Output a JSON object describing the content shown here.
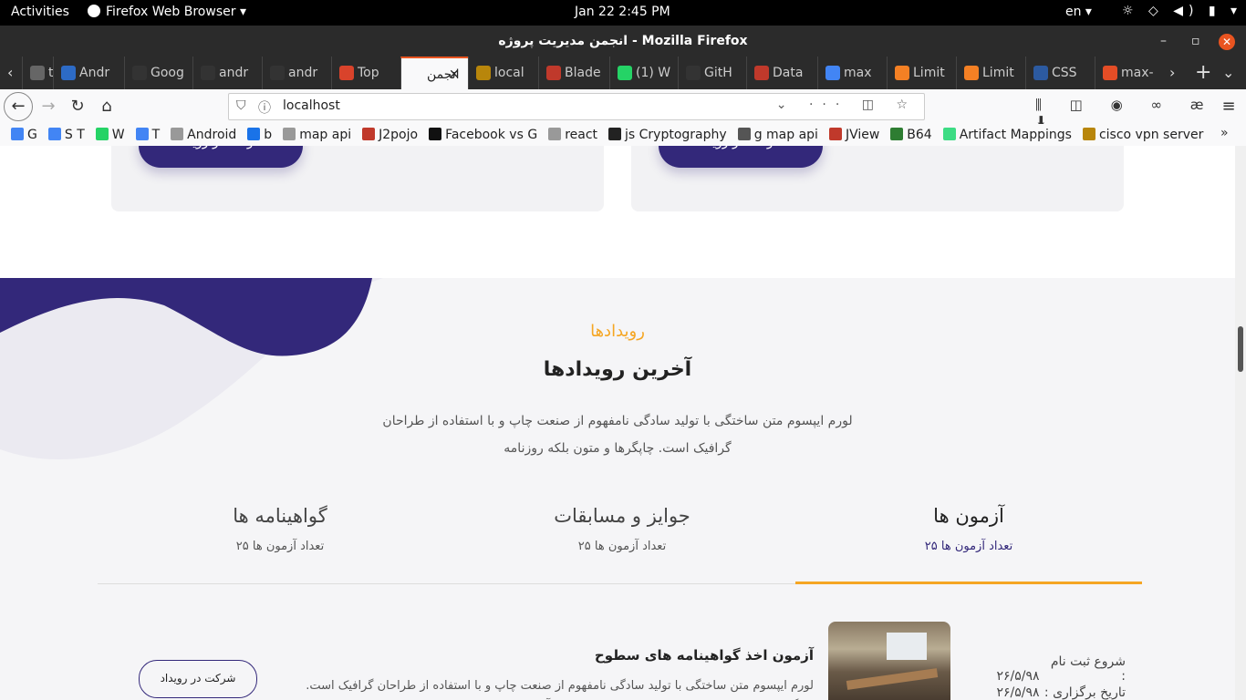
{
  "system": {
    "activities": "Activities",
    "app_menu": "Firefox Web Browser ▾",
    "clock": "Jan 22   2:45 PM",
    "lang": "en ▾",
    "tray_icons": "brightness-icon wifi-icon volume-icon battery-icon"
  },
  "window": {
    "title": "انجمن مدیریت پروژه - Mozilla Firefox"
  },
  "tabs": [
    {
      "label": "tHt",
      "color": "#666"
    },
    {
      "label": "Andr",
      "color": "#2d6bc6"
    },
    {
      "label": "Goog",
      "color": "#333"
    },
    {
      "label": "andr",
      "color": "#333"
    },
    {
      "label": "andr",
      "color": "#333"
    },
    {
      "label": "Top",
      "color": "#d9432b"
    },
    {
      "label": "انجمن",
      "color": "#f9f9fa"
    },
    {
      "label": "local",
      "color": "#b8860b"
    },
    {
      "label": "Blade",
      "color": "#c0392b"
    },
    {
      "label": "(1) W",
      "color": "#25d366"
    },
    {
      "label": "GitH",
      "color": "#333"
    },
    {
      "label": "Data",
      "color": "#c0392b"
    },
    {
      "label": "max",
      "color": "#4285f4"
    },
    {
      "label": "Limit",
      "color": "#f48024"
    },
    {
      "label": "Limit",
      "color": "#f48024"
    },
    {
      "label": "CSS",
      "color": "#2c5aa0"
    },
    {
      "label": "max-",
      "color": "#e44d26"
    }
  ],
  "nav": {
    "url": "localhost"
  },
  "bookmarks": [
    {
      "label": "G",
      "color": "#4285f4"
    },
    {
      "label": "S T",
      "color": "#4285f4"
    },
    {
      "label": "W",
      "color": "#25d366"
    },
    {
      "label": "T",
      "color": "#4285f4"
    },
    {
      "label": "Android",
      "color": "#999"
    },
    {
      "label": "b",
      "color": "#1a73e8"
    },
    {
      "label": "map api",
      "color": "#999"
    },
    {
      "label": "J2pojo",
      "color": "#c0392b"
    },
    {
      "label": "Facebook vs G",
      "color": "#111"
    },
    {
      "label": "react",
      "color": "#999"
    },
    {
      "label": "js Cryptography",
      "color": "#222"
    },
    {
      "label": "g map api",
      "color": "#555"
    },
    {
      "label": "JView",
      "color": "#c0392b"
    },
    {
      "label": "B64",
      "color": "#2e7d32"
    },
    {
      "label": "Artifact Mappings",
      "color": "#3ddc84"
    },
    {
      "label": "cisco vpn server",
      "color": "#b8860b"
    }
  ],
  "cards": {
    "join_label": "شرکت در رویداد"
  },
  "events": {
    "kicker": "رویدادها",
    "heading": "آخرین رویدادها",
    "description": "لورم ایپسوم متن ساختگی با تولید سادگی نامفهوم از صنعت چاپ و با استفاده از طراحان گرافیک است. چاپگرها و متون بلکه روزنامه",
    "tabs": [
      {
        "title": "آزمون ها",
        "count": "تعداد آزمون ها ۲۵"
      },
      {
        "title": "جوایز و مسابقات",
        "count": "تعداد آزمون ها ۲۵"
      },
      {
        "title": "گواهینامه ها",
        "count": "تعداد آزمون ها ۲۵"
      }
    ],
    "item": {
      "title": "آزمون اخذ گواهینامه های سطوح",
      "text": "لورم ایپسوم متن ساختگی با تولید سادگی نامفهوم از صنعت چاپ و با استفاده از طراحان گرافیک است. چاپگرها و متون بلکه روزنامه و مجله در ستون و سطرآنچنان که لازم است",
      "reg_start_label": "شروع ثبت نام :",
      "reg_start_value": "۲۶/۵/۹۸",
      "date_label": "تاریخ برگزاری :",
      "date_value": "۲۶/۵/۹۸",
      "join_label": "شرکت در رویداد"
    }
  },
  "colors": {
    "brand": "#33287a",
    "accent": "#f5a623"
  }
}
